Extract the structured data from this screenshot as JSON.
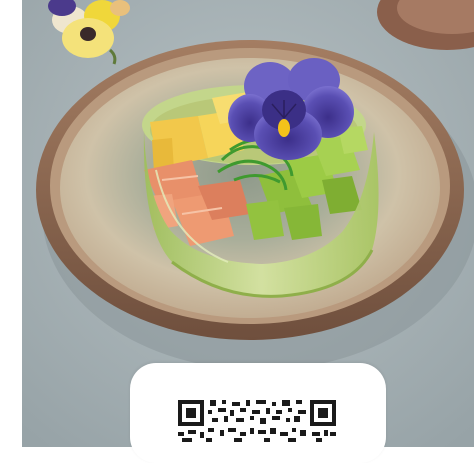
{
  "photo": {
    "subject": "salmon-avocado-mango-poke-tartare-with-pansy",
    "colors": {
      "background": "#a8b3b6",
      "plate_rim": "#8e6a52",
      "plate_inner": "#cbbda5",
      "plate_center": "#9fa897",
      "cucumber_ring": "#b9cf7d",
      "salmon": "#e8906a",
      "avocado": "#8fbf3c",
      "mango": "#f2c84b",
      "pansy_petal": "#5b4fb0",
      "pansy_center": "#f4c21a",
      "seaweed": "#3f9a2f"
    }
  },
  "qr": {
    "icon": "qr-code-icon",
    "colors": {
      "card": "#ffffff",
      "modules": "#1a1a1a"
    }
  }
}
